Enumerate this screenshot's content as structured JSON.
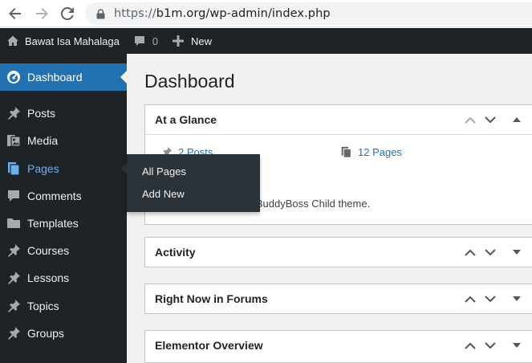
{
  "browser": {
    "url_scheme": "https://",
    "url_rest": "b1m.org/wp-admin/index.php"
  },
  "admin_bar": {
    "site_name": "Bawat Isa Mahalaga",
    "comments_count": "0",
    "new_label": "New"
  },
  "sidebar": {
    "items": [
      {
        "label": "Dashboard",
        "icon": "dashboard-icon"
      },
      {
        "label": "Posts",
        "icon": "pin-icon"
      },
      {
        "label": "Media",
        "icon": "media-icon"
      },
      {
        "label": "Pages",
        "icon": "pages-icon"
      },
      {
        "label": "Comments",
        "icon": "comment-icon"
      },
      {
        "label": "Templates",
        "icon": "folder-icon"
      },
      {
        "label": "Courses",
        "icon": "pin-icon"
      },
      {
        "label": "Lessons",
        "icon": "pin-icon"
      },
      {
        "label": "Topics",
        "icon": "pin-icon"
      },
      {
        "label": "Groups",
        "icon": "pin-icon"
      }
    ]
  },
  "flyout": {
    "items": [
      "All Pages",
      "Add New"
    ]
  },
  "main": {
    "title": "Dashboard",
    "widgets": [
      {
        "title": "At a Glance"
      },
      {
        "title": "Activity"
      },
      {
        "title": "Right Now in Forums"
      },
      {
        "title": "Elementor Overview"
      }
    ],
    "glance": {
      "posts": "2 Posts",
      "pages": "12 Pages",
      "theme_text": "g BuddyBoss Child theme."
    }
  },
  "colors": {
    "admin_dark": "#1d2327",
    "accent": "#2271b1",
    "flyout": "#2c3338",
    "link": "#2271b1",
    "hover_link": "#72aee6"
  }
}
